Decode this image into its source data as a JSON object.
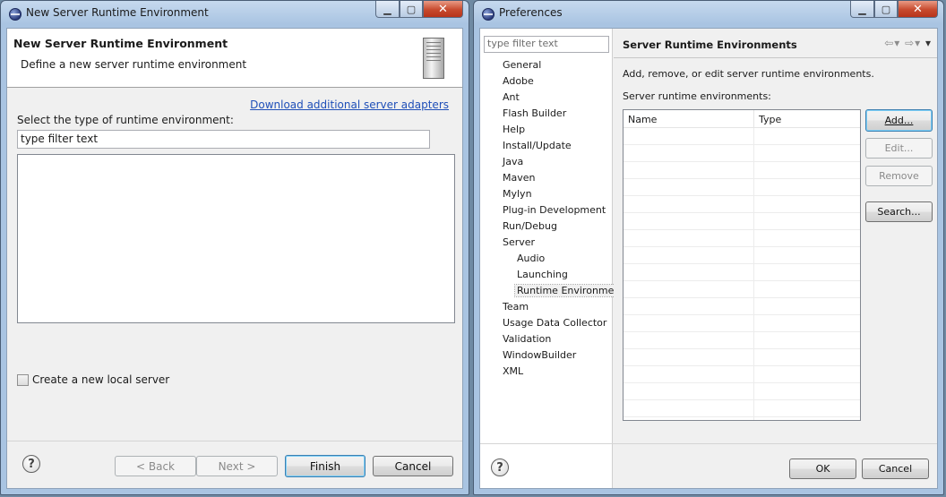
{
  "left_window": {
    "title": "New Server Runtime Environment",
    "header_title": "New Server Runtime Environment",
    "header_description": "Define a new server runtime environment",
    "download_link": "Download additional server adapters",
    "select_label": "Select the type of runtime environment:",
    "filter_value": "type filter text",
    "checkbox_label": "Create a new local server",
    "checkbox_checked": false,
    "buttons": {
      "back": "< Back",
      "next": "Next >",
      "finish": "Finish",
      "cancel": "Cancel"
    },
    "help_icon": "help-icon"
  },
  "right_window": {
    "title": "Preferences",
    "filter_placeholder": "type filter text",
    "tree": [
      {
        "label": "General",
        "level": 0
      },
      {
        "label": "Adobe",
        "level": 0
      },
      {
        "label": "Ant",
        "level": 0
      },
      {
        "label": "Flash Builder",
        "level": 0
      },
      {
        "label": "Help",
        "level": 0
      },
      {
        "label": "Install/Update",
        "level": 0
      },
      {
        "label": "Java",
        "level": 0
      },
      {
        "label": "Maven",
        "level": 0
      },
      {
        "label": "Mylyn",
        "level": 0
      },
      {
        "label": "Plug-in Development",
        "level": 0
      },
      {
        "label": "Run/Debug",
        "level": 0
      },
      {
        "label": "Server",
        "level": 0
      },
      {
        "label": "Audio",
        "level": 1
      },
      {
        "label": "Launching",
        "level": 1
      },
      {
        "label": "Runtime Environments",
        "level": 1,
        "selected": true
      },
      {
        "label": "Team",
        "level": 0
      },
      {
        "label": "Usage Data Collector",
        "level": 0
      },
      {
        "label": "Validation",
        "level": 0
      },
      {
        "label": "WindowBuilder",
        "level": 0
      },
      {
        "label": "XML",
        "level": 0
      }
    ],
    "page_title": "Server Runtime Environments",
    "page_description": "Add, remove, or edit server runtime environments.",
    "table_label": "Server runtime environments:",
    "table_columns": [
      "Name",
      "Type"
    ],
    "table_rows": [],
    "side_buttons": {
      "add": "Add...",
      "edit": "Edit...",
      "remove": "Remove",
      "search": "Search..."
    },
    "buttons": {
      "ok": "OK",
      "cancel": "Cancel"
    },
    "nav_icons": [
      "back-arrow-icon",
      "forward-arrow-icon",
      "view-menu-icon"
    ]
  },
  "colors": {
    "title_bar": "#a9c4e2",
    "link": "#1f4fb8",
    "close_button": "#c74a2e"
  }
}
